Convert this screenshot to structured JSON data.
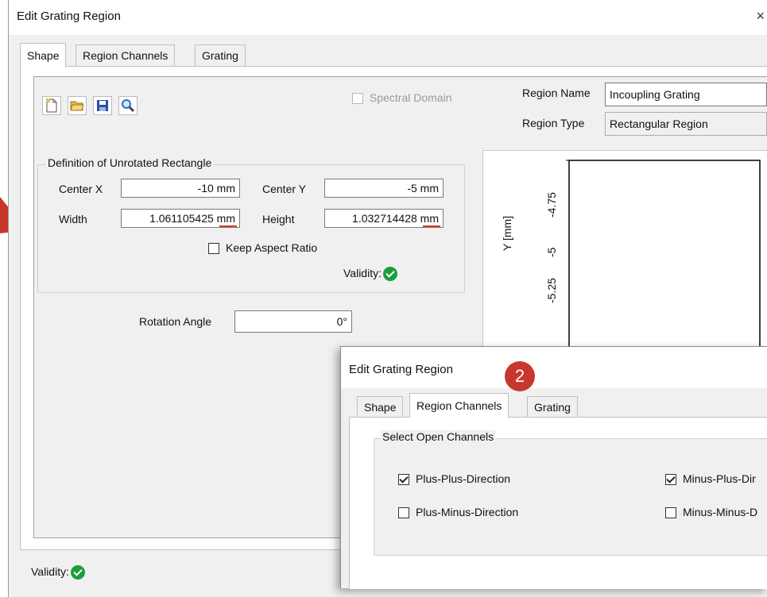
{
  "main_dialog": {
    "title": "Edit Grating Region",
    "close": "×",
    "tabs": [
      "Shape",
      "Region Channels",
      "Grating"
    ],
    "spectral_domain_label": "Spectral Domain",
    "region_name_label": "Region Name",
    "region_name_value": "Incoupling Grating",
    "region_type_label": "Region Type",
    "region_type_value": "Rectangular Region",
    "group_title": "Definition of Unrotated Rectangle",
    "center_x_label": "Center X",
    "center_x_value": "-10 mm",
    "center_y_label": "Center Y",
    "center_y_value": "-5 mm",
    "width_label": "Width",
    "width_value": "1.061105425 mm",
    "height_label": "Height",
    "height_value": "1.032714428 mm",
    "keep_aspect_label": "Keep Aspect Ratio",
    "group_validity_label": "Validity:",
    "rotation_label": "Rotation Angle",
    "rotation_value": "0°",
    "footer_validity_label": "Validity:",
    "plot": {
      "ylabel": "Y [mm]",
      "yticks": [
        "-4.75",
        "-5",
        "-5.25"
      ]
    }
  },
  "overlay_dialog": {
    "title": "Edit Grating Region",
    "badge": "2",
    "tabs": [
      "Shape",
      "Region Channels",
      "Grating"
    ],
    "group_title": "Select Open Channels",
    "channels": [
      {
        "label": "Plus-Plus-Direction",
        "checked": true
      },
      {
        "label": "Minus-Plus-Dir",
        "checked": true
      },
      {
        "label": "Plus-Minus-Direction",
        "checked": false
      },
      {
        "label": "Minus-Minus-D",
        "checked": false
      }
    ]
  },
  "colors": {
    "validity_ok": "#1a9e3b",
    "badge": "#c9372c",
    "annotation_arrow": "#c9372c"
  }
}
